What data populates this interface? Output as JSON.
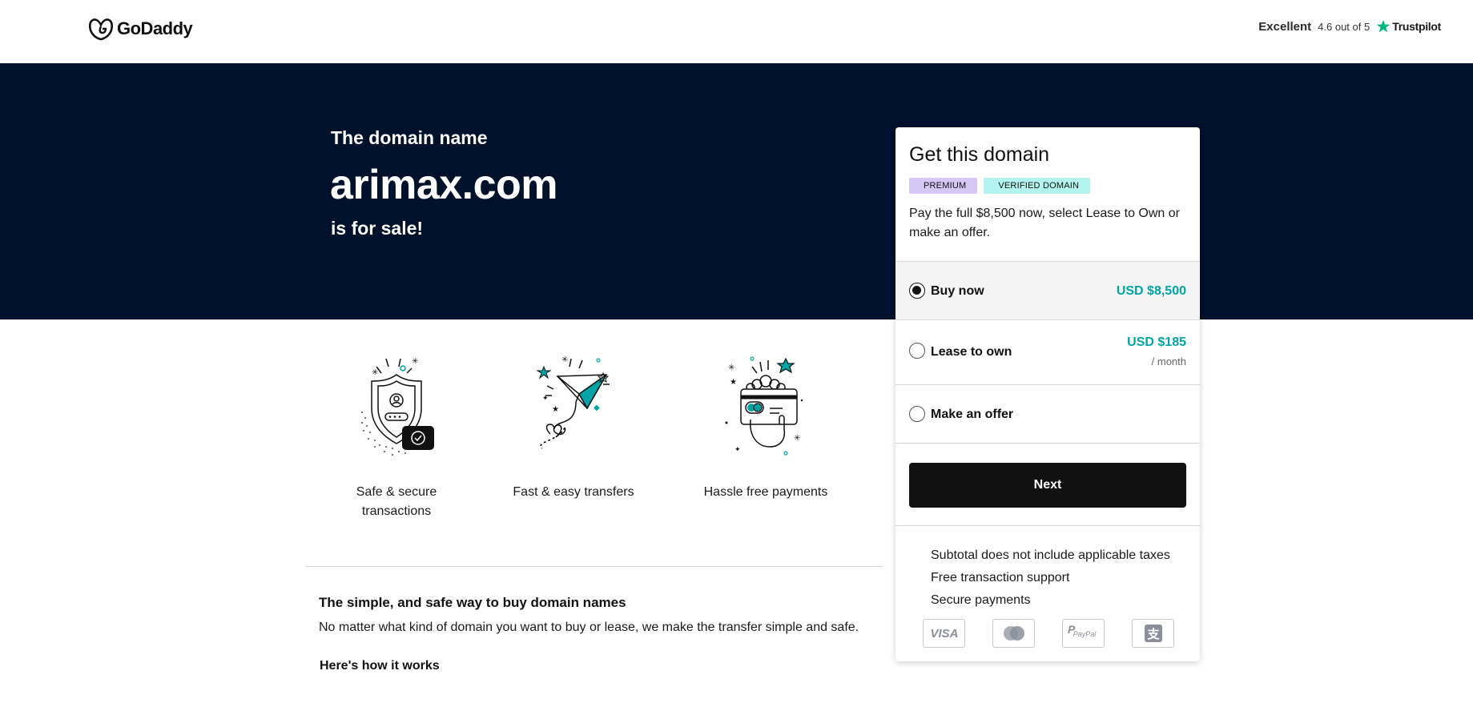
{
  "header": {
    "logo_text": "GoDaddy",
    "trust_rating_word": "Excellent",
    "trust_score": "4.6 out of 5",
    "trust_brand": "Trustpilot"
  },
  "hero": {
    "pre": "The domain name",
    "domain": "arimax.com",
    "post": "is for sale!"
  },
  "features": [
    {
      "label": "Safe & secure transactions",
      "icon": "shield-icon"
    },
    {
      "label": "Fast & easy transfers",
      "icon": "paper-plane-icon"
    },
    {
      "label": "Hassle free payments",
      "icon": "card-payment-icon"
    }
  ],
  "info": {
    "title": "The simple, and safe way to buy domain names",
    "text": "No matter what kind of domain you want to buy or lease, we make the transfer simple and safe.",
    "how": "Here's how it works"
  },
  "card": {
    "title": "Get this domain",
    "badges": [
      "PREMIUM",
      "VERIFIED DOMAIN"
    ],
    "description": "Pay the full $8,500 now, select Lease to Own or make an offer.",
    "options": [
      {
        "label": "Buy now",
        "price": "USD $8,500",
        "sub": "",
        "selected": true
      },
      {
        "label": "Lease to own",
        "price": "USD $185",
        "sub": "/ month",
        "selected": false
      },
      {
        "label": "Make an offer",
        "price": "",
        "sub": "",
        "selected": false
      }
    ],
    "next_label": "Next",
    "perks": [
      "Subtotal does not include applicable taxes",
      "Free transaction support",
      "Secure payments"
    ],
    "payment_methods": [
      "VISA",
      "Mastercard",
      "PayPal",
      "Alipay"
    ]
  },
  "colors": {
    "hero_bg": "#00112c",
    "accent": "#00a4a6",
    "premium_badge": "#d6c7f5",
    "verified_badge": "#b3f4ef",
    "trustpilot_star": "#00b67a"
  }
}
